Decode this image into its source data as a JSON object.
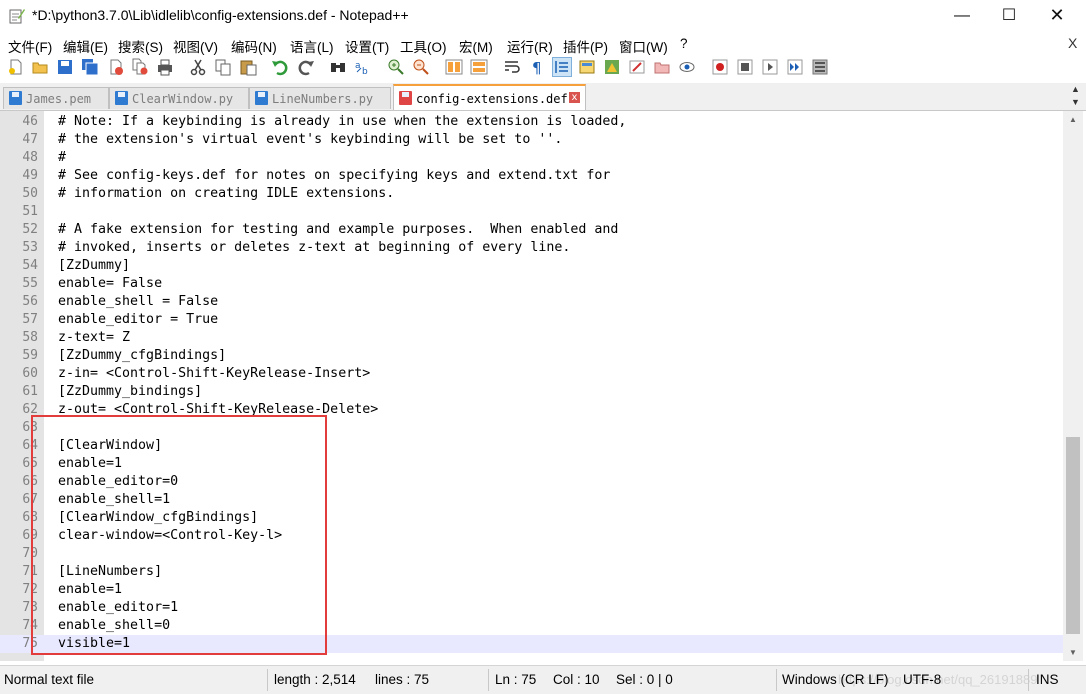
{
  "window": {
    "title": "*D:\\python3.7.0\\Lib\\idlelib\\config-extensions.def - Notepad++",
    "minimize": "—",
    "maximize": "☐",
    "close": "✕"
  },
  "menu": {
    "items": [
      "文件(F)",
      "编辑(E)",
      "搜索(S)",
      "视图(V)",
      "编码(N)",
      "语言(L)",
      "设置(T)",
      "工具(O)",
      "宏(M)",
      "运行(R)",
      "插件(P)",
      "窗口(W)",
      "?"
    ],
    "close_doc": "X"
  },
  "toolbar": {
    "icons": [
      "new-file-icon",
      "open-file-icon",
      "save-icon",
      "save-all-icon",
      "close-icon",
      "close-all-icon",
      "print-icon",
      "cut-icon",
      "copy-icon",
      "paste-icon",
      "undo-icon",
      "redo-icon",
      "find-icon",
      "replace-icon",
      "zoom-in-icon",
      "zoom-out-icon",
      "sync-vertical-icon",
      "sync-horizontal-icon",
      "word-wrap-icon",
      "show-all-chars-icon",
      "indent-guide-icon",
      "udl-icon",
      "doc-map-icon",
      "function-list-icon",
      "folder-workspace-icon",
      "monitoring-icon",
      "record-macro-icon",
      "stop-macro-icon",
      "play-macro-icon",
      "run-macro-multiple-icon",
      "save-macro-icon"
    ]
  },
  "tabs": [
    {
      "label": "James.pem",
      "active": false
    },
    {
      "label": "ClearWindow.py",
      "active": false
    },
    {
      "label": "LineNumbers.py",
      "active": false
    },
    {
      "label": "config-extensions.def",
      "active": true
    }
  ],
  "tab_close": "x",
  "editor": {
    "lines": [
      {
        "n": "46",
        "text": "# Note: If a keybinding is already in use when the extension is loaded,"
      },
      {
        "n": "47",
        "text": "# the extension's virtual event's keybinding will be set to ''."
      },
      {
        "n": "48",
        "text": "#"
      },
      {
        "n": "49",
        "text": "# See config-keys.def for notes on specifying keys and extend.txt for"
      },
      {
        "n": "50",
        "text": "# information on creating IDLE extensions."
      },
      {
        "n": "51",
        "text": ""
      },
      {
        "n": "52",
        "text": "# A fake extension for testing and example purposes.  When enabled and"
      },
      {
        "n": "53",
        "text": "# invoked, inserts or deletes z-text at beginning of every line."
      },
      {
        "n": "54",
        "text": "[ZzDummy]"
      },
      {
        "n": "55",
        "text": "enable= False"
      },
      {
        "n": "56",
        "text": "enable_shell = False"
      },
      {
        "n": "57",
        "text": "enable_editor = True"
      },
      {
        "n": "58",
        "text": "z-text= Z"
      },
      {
        "n": "59",
        "text": "[ZzDummy_cfgBindings]"
      },
      {
        "n": "60",
        "text": "z-in= <Control-Shift-KeyRelease-Insert>"
      },
      {
        "n": "61",
        "text": "[ZzDummy_bindings]"
      },
      {
        "n": "62",
        "text": "z-out= <Control-Shift-KeyRelease-Delete>"
      },
      {
        "n": "63",
        "text": ""
      },
      {
        "n": "64",
        "text": "[ClearWindow]"
      },
      {
        "n": "65",
        "text": "enable=1"
      },
      {
        "n": "66",
        "text": "enable_editor=0"
      },
      {
        "n": "67",
        "text": "enable_shell=1"
      },
      {
        "n": "68",
        "text": "[ClearWindow_cfgBindings]"
      },
      {
        "n": "69",
        "text": "clear-window=<Control-Key-l>"
      },
      {
        "n": "70",
        "text": ""
      },
      {
        "n": "71",
        "text": "[LineNumbers]"
      },
      {
        "n": "72",
        "text": "enable=1"
      },
      {
        "n": "73",
        "text": "enable_editor=1"
      },
      {
        "n": "74",
        "text": "enable_shell=0"
      },
      {
        "n": "75",
        "text": "visible=1"
      }
    ],
    "current_line": "75"
  },
  "scrollbar": {
    "up": "▲",
    "down": "▼"
  },
  "status": {
    "filetype": "Normal text file",
    "length": "length : 2,514",
    "lines": "lines : 75",
    "ln": "Ln : 75",
    "col": "Col : 10",
    "sel": "Sel : 0 | 0",
    "eol": "Windows (CR LF)",
    "encoding": "UTF-8",
    "mode": "INS",
    "watermark": "https://blog.csdn.net/qq_26191889"
  },
  "colors": {
    "highlight_box": "#e23c3c",
    "active_tab_accent": "#f5a03a",
    "current_line_bg": "#e8e8ff",
    "gutter_bg": "#e4e4e4"
  }
}
